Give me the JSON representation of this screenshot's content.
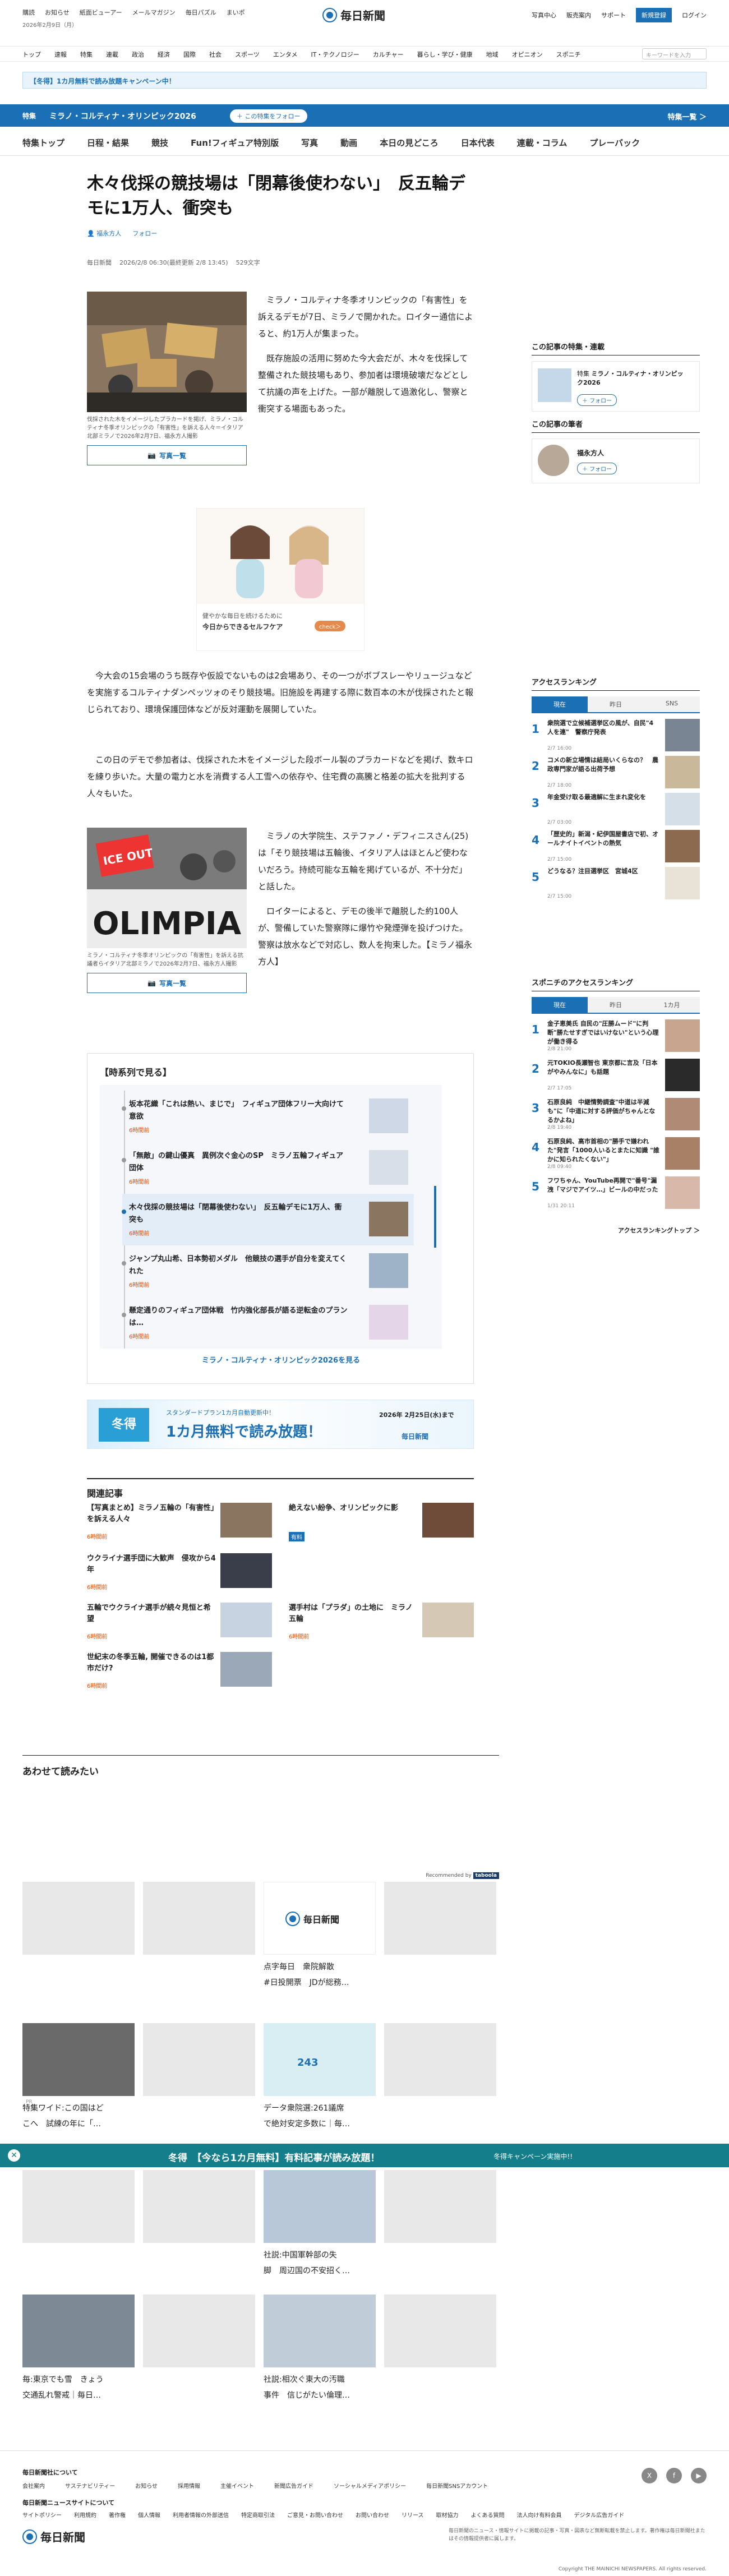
{
  "header": {
    "links": [
      "購読",
      "お知らせ",
      "紙面ビューアー",
      "メールマガジン",
      "毎日パズル",
      "まいポ"
    ],
    "date": "2026年2月9日（月）",
    "logo": "毎日新聞",
    "right": [
      "写真中心",
      "販売案内",
      "サポート",
      "新規登録",
      "ログイン"
    ]
  },
  "nav": {
    "items": [
      "トップ",
      "速報",
      "特集",
      "連載",
      "政治",
      "経済",
      "国際",
      "社会",
      "スポーツ",
      "エンタメ",
      "IT・テクノロジー",
      "カルチャー",
      "暮らし・学び・健康",
      "地域",
      "オピニオン",
      "スポニチ"
    ],
    "search_placeholder": "キーワードを入力"
  },
  "campaign": "【冬得】1カ月無料で読み放題キャンペーン中！",
  "tokushu": {
    "label": "特集",
    "title": "ミラノ・コルティナ・オリンピック2026",
    "follow": "＋ この特集をフォロー",
    "list": "特集一覧 ＞"
  },
  "subnav": [
    "特集トップ",
    "日程・結果",
    "競技",
    "Fun!フィギュア特別版",
    "写真",
    "動画",
    "本日の見どころ",
    "日本代表",
    "連載・コラム",
    "プレーバック"
  ],
  "article": {
    "title": "木々伐採の競技場は「閉幕後使わない」　反五輪デモに1万人、衝突も",
    "author": "福永方人",
    "follow": "フォロー",
    "meta": [
      "毎日新聞",
      "2026/2/8 06:30(最終更新 2/8 13:45)",
      "529文字"
    ],
    "fig1_caption": "伐採された木をイメージしたプラカードを掲げ、ミラノ・コルティナ冬季オリンピックの「有害性」を訴える人々＝イタリア北部ミラノで2026年2月7日、福永方人撮影",
    "photos": "写真一覧",
    "p1": "　ミラノ・コルティナ冬季オリンピックの「有害性」を訴えるデモが7日、ミラノで開かれた。ロイター通信によると、約1万人が集まった。",
    "p2": "　既存施設の活用に努めた今大会だが、木々を伐採して整備された競技場もあり、参加者は環境破壊だなどとして抗議の声を上げた。一部が離脱して過激化し、警察と衝突する場面もあった。",
    "p3": "　今大会の15会場のうち既存や仮設でないものは2会場あり、その一つがボブスレーやリュージュなどを実施するコルティナダンペッツォのそり競技場。旧施設を再建する際に数百本の木が伐採されたと報じられており、環境保護団体などが反対運動を展開していた。",
    "p4": "　この日のデモで参加者は、伐採された木をイメージした段ボール製のプラカードなどを掲げ、数キロを練り歩いた。大量の電力と水を消費する人工雪への依存や、住宅費の高騰と格差の拡大を批判する人々もいた。",
    "fig2_caption": "ミラノ・コルティナ冬季オリンピックの「有害性」を訴える抗議者らイタリア北部ミラノで2026年2月7日、福永方人撮影",
    "p5": "　ミラノの大学院生、ステファノ・デフィニスさん(25)は「そり競技場は五輪後、イタリア人はほとんど使わないだろう。持続可能な五輪を掲げているが、不十分だ」と話した。",
    "p6": "　ロイターによると、デモの後半で離脱した約100人が、警備していた警察隊に爆竹や発煙弾を投げつけた。警察は放水などで対応し、数人を拘束した。【ミラノ福永方人】"
  },
  "ad": {
    "line1": "健やかな毎日を続けるために",
    "line2": "今日からできるセルフケア",
    "cta": "check＞"
  },
  "timeline": {
    "heading": "【時系列で見る】",
    "items": [
      {
        "title": "坂本花織「これは熱い、まじで」　フィギュア団体フリー大向けて意欲",
        "ago": "6時間前"
      },
      {
        "title": "「無敵」の鍵山優真　異例次ぐ金心のSP　ミラノ五輪フィギュア団体",
        "ago": "6時間前"
      },
      {
        "title": "木々伐採の競技場は「閉幕後使わない」　反五輪デモに1万人、衝突も",
        "ago": "6時間前"
      },
      {
        "title": "ジャンプ丸山希、日本勢初メダル　他競技の選手が自分を変えてくれた",
        "ago": "6時間前"
      },
      {
        "title": "懸定通りのフィギュア団体戦　竹内強化部長が語る逆転金のプランは…",
        "ago": "6時間前"
      }
    ],
    "more": "ミラノ・コルティナ・オリンピック2026を見る"
  },
  "banner": {
    "left": "冬得",
    "mid": "スタンダードプラン1カ月自動更新中！",
    "big": "1カ月無料で読み放題！",
    "date": "2026年 2月25日(水)まで",
    "right": "毎日新聞"
  },
  "related": {
    "heading": "関連記事",
    "items": [
      {
        "title": "【写真まとめ】ミラノ五輪の「有害性」を訴える人々",
        "ago": "6時間前"
      },
      {
        "title": "絶えない紛争、オリンピックに影",
        "ago": "有料"
      },
      {
        "title": "ウクライナ選手団に大歓声　侵攻から4年",
        "ago": "6時間前"
      },
      {
        "title": "五輪でウクライナ選手が続々見恒と希望",
        "ago": "6時間前"
      },
      {
        "title": "選手村は「プラダ」の土地に　ミラノ五輪",
        "ago": "6時間前"
      },
      {
        "title": "世紀末の冬季五輪, 開催できるのは1都市だけ?",
        "ago": "6時間前"
      }
    ]
  },
  "sidebar": {
    "tokushu_h": "この記事の特集・連載",
    "tokushu_label": "特集",
    "tokushu_title": "ミラノ・コルティナ・オリンピック2026",
    "follow": "＋ フォロー",
    "author_h": "この記事の筆者",
    "author": "福永方人",
    "rank_h": "アクセスランキング",
    "rank_tabs": [
      "現在",
      "昨日",
      "SNS"
    ],
    "rank": [
      {
        "t": "衆院選で立候補選挙区の風が、自民\"4人を連\"　警察庁発表",
        "time": "2/7 16:00"
      },
      {
        "t": "コメの新立場情は結局いくらなの？　農政専門家が語る出荷予想",
        "time": "2/7 18:00"
      },
      {
        "t": "年金受け取る最適解に生まれ変化を",
        "time": "2/7 03:00"
      },
      {
        "t": "「歴史的」新潟・紀伊国屋書店で初、オールナイトイベントの熱気",
        "time": "2/7 15:00"
      },
      {
        "t": "どうなる？注目選挙区　宮城4区",
        "time": "2/7 15:00"
      }
    ],
    "spon_h": "スポニチのアクセスランキング",
    "spon_tabs": [
      "現在",
      "昨日",
      "1カ月"
    ],
    "spon": [
      {
        "t": "金子恵美氏 自民の\"圧勝ムード\"に判断\"勝たせすぎではいけない\"という心理が働き得る",
        "time": "2/8 21:00"
      },
      {
        "t": "元TOKIO長瀬智也 東京都に言及「日本がやみんなに」も話題",
        "time": "2/7 17:05"
      },
      {
        "t": "石原良純　中継情勢調査\"中道は半減も\"に「中道に対する評価がちゃんとなるかよね」",
        "time": "2/8 19:40"
      },
      {
        "t": "石原良純、高市首相の\"勝手で嫌われた\"発言「1000人いるとまたに知識 \"誰かに知られたくない\"」",
        "time": "2/8 09:40"
      },
      {
        "t": "フワちゃん、YouTube再開で\"番号\"漏洩「マジでアイツ…」ビールの中だった",
        "time": "1/31 20:11"
      }
    ],
    "rank_more": "アクセスランキングトップ ＞"
  },
  "awase": {
    "heading": "あわせて読みたい",
    "recommended": "Recommended by",
    "cards": [
      "点字毎日　衆院解散\n#日投開票　JDが総務…",
      "特集ワイド:この国はど\nこへ　試練の年に「…",
      "データ衆院選:261議席\nで絶対安定多数に｜毎…",
      "社説:中国軍幹部の失\n脚　周辺国の不安招く…",
      "毎:東京でも雪　きょう\n交通乱れ警戒｜毎日…",
      "社説:相次ぐ東大の汚職\n事件　信じがたい倫理…"
    ],
    "pr": "PR"
  },
  "floatbar": {
    "text": "冬得　【今なら1カ月無料】有料記事が読み放題！",
    "sub": "冬得キャンペーン実施中!!"
  },
  "footer": {
    "about_h": "毎日新聞社について",
    "about": [
      "会社案内",
      "サステナビリティー",
      "お知らせ",
      "採用情報",
      "主催イベント",
      "新聞広告ガイド",
      "ソーシャルメディアポリシー",
      "毎日新聞SNSアカウント"
    ],
    "site_h": "毎日新聞ニュースサイトについて",
    "site": [
      "サイトポリシー",
      "利用規約",
      "著作権",
      "個人情報",
      "利用者情報の外部送信",
      "特定商取引法",
      "ご意見・お問い合わせ",
      "お問い合わせ",
      "リリース",
      "取材協力",
      "よくある質問",
      "法人向け有料会員",
      "デジタル広告ガイド"
    ],
    "copyright": "Copyright THE MAINICHI NEWSPAPERS. All rights reserved.",
    "note": "毎日新聞のニュース・情報サイトに掲載の記事・写真・図表など無断転載を禁止します。著作権は毎日新聞社またはその情報提供者に属します。"
  },
  "colors": {
    "brand": "#1a6fb5",
    "teal": "#147f8a",
    "accent": "#e54b00"
  }
}
